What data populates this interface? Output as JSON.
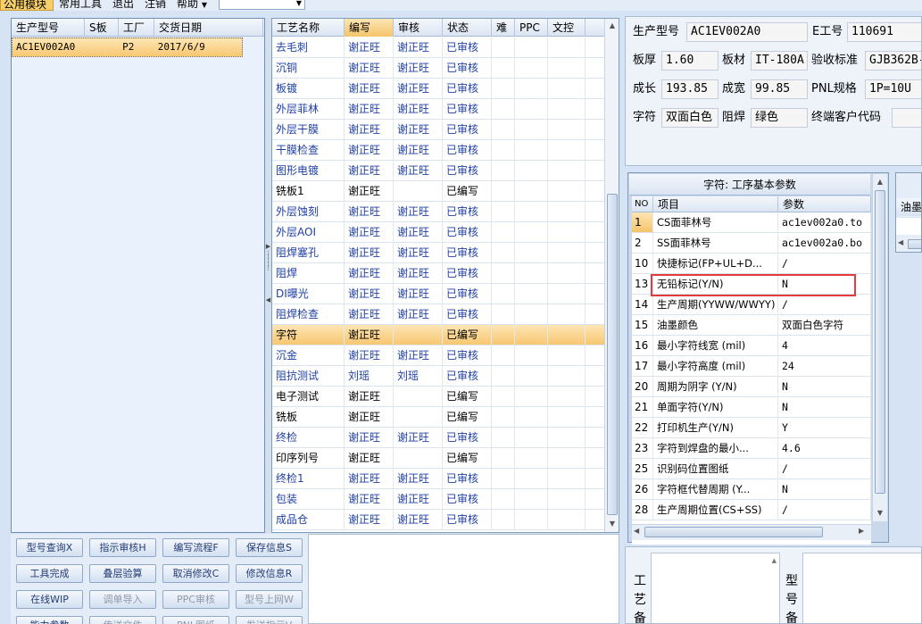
{
  "menubar": {
    "items": [
      "公用模块",
      "常用工具",
      "退出",
      "注销",
      "帮助"
    ],
    "dropdown_value": ""
  },
  "orders": {
    "columns": [
      "生产型号",
      "S板",
      "工厂",
      "交货日期"
    ],
    "rows": [
      [
        "AC1EV002A0",
        "",
        "P2",
        "2017/6/9"
      ]
    ]
  },
  "process": {
    "columns": [
      "工艺名称",
      "编写",
      "审核",
      "状态",
      "难",
      "PPC",
      "文控"
    ],
    "rows": [
      {
        "name": "去毛刺",
        "writer": "谢正旺",
        "reviewer": "谢正旺",
        "status": "已审核"
      },
      {
        "name": "沉铜",
        "writer": "谢正旺",
        "reviewer": "谢正旺",
        "status": "已审核"
      },
      {
        "name": "板镀",
        "writer": "谢正旺",
        "reviewer": "谢正旺",
        "status": "已审核"
      },
      {
        "name": "外层菲林",
        "writer": "谢正旺",
        "reviewer": "谢正旺",
        "status": "已审核"
      },
      {
        "name": "外层干膜",
        "writer": "谢正旺",
        "reviewer": "谢正旺",
        "status": "已审核"
      },
      {
        "name": "干膜检查",
        "writer": "谢正旺",
        "reviewer": "谢正旺",
        "status": "已审核"
      },
      {
        "name": "图形电镀",
        "writer": "谢正旺",
        "reviewer": "谢正旺",
        "status": "已审核"
      },
      {
        "name": "铣板1",
        "writer": "谢正旺",
        "reviewer": "",
        "status": "已编写"
      },
      {
        "name": "外层蚀刻",
        "writer": "谢正旺",
        "reviewer": "谢正旺",
        "status": "已审核"
      },
      {
        "name": "外层AOI",
        "writer": "谢正旺",
        "reviewer": "谢正旺",
        "status": "已审核"
      },
      {
        "name": "阻焊塞孔",
        "writer": "谢正旺",
        "reviewer": "谢正旺",
        "status": "已审核"
      },
      {
        "name": "阻焊",
        "writer": "谢正旺",
        "reviewer": "谢正旺",
        "status": "已审核"
      },
      {
        "name": "DI曝光",
        "writer": "谢正旺",
        "reviewer": "谢正旺",
        "status": "已审核"
      },
      {
        "name": "阻焊检查",
        "writer": "谢正旺",
        "reviewer": "谢正旺",
        "status": "已审核"
      },
      {
        "name": "字符",
        "writer": "谢正旺",
        "reviewer": "",
        "status": "已编写"
      },
      {
        "name": "沉金",
        "writer": "谢正旺",
        "reviewer": "谢正旺",
        "status": "已审核"
      },
      {
        "name": "阻抗测试",
        "writer": "刘瑶",
        "reviewer": "刘瑶",
        "status": "已审核"
      },
      {
        "name": "电子测试",
        "writer": "谢正旺",
        "reviewer": "",
        "status": "已编写"
      },
      {
        "name": "铣板",
        "writer": "谢正旺",
        "reviewer": "",
        "status": "已编写"
      },
      {
        "name": "终检",
        "writer": "谢正旺",
        "reviewer": "谢正旺",
        "status": "已审核"
      },
      {
        "name": "印序列号",
        "writer": "谢正旺",
        "reviewer": "",
        "status": "已编写"
      },
      {
        "name": "终检1",
        "writer": "谢正旺",
        "reviewer": "谢正旺",
        "status": "已审核"
      },
      {
        "name": "包装",
        "writer": "谢正旺",
        "reviewer": "谢正旺",
        "status": "已审核"
      },
      {
        "name": "成品仓",
        "writer": "谢正旺",
        "reviewer": "谢正旺",
        "status": "已审核"
      }
    ]
  },
  "buttons": [
    {
      "label": "型号查询X",
      "enabled": true
    },
    {
      "label": "指示审核H",
      "enabled": true
    },
    {
      "label": "编写流程F",
      "enabled": true
    },
    {
      "label": "保存信息S",
      "enabled": true
    },
    {
      "label": "工具完成",
      "enabled": true
    },
    {
      "label": "叠层验算",
      "enabled": true
    },
    {
      "label": "取消修改C",
      "enabled": true
    },
    {
      "label": "修改信息R",
      "enabled": true
    },
    {
      "label": "在线WIP",
      "enabled": true
    },
    {
      "label": "调单导入",
      "enabled": false
    },
    {
      "label": "PPC审核",
      "enabled": false
    },
    {
      "label": "型号上网W",
      "enabled": false
    },
    {
      "label": "能力参数",
      "enabled": true
    },
    {
      "label": "传送文件",
      "enabled": false
    },
    {
      "label": "PNL图纸",
      "enabled": false
    },
    {
      "label": "发送指示V",
      "enabled": false
    }
  ],
  "info": {
    "model_label": "生产型号",
    "model_value": "AC1EV002A0",
    "eno_label": "E工号",
    "eno_value": "110691",
    "thickness_label": "板厚",
    "thickness_value": "1.60",
    "material_label": "板材",
    "material_value": "IT-180A",
    "standard_label": "验收标准",
    "standard_value": "GJB362B-",
    "length_label": "成长",
    "length_value": "193.85",
    "width_label": "成宽",
    "width_value": "99.85",
    "pnl_label": "PNL规格",
    "pnl_value": "1P=10U",
    "legend_label": "字符",
    "legend_value": "双面白色",
    "mask_label": "阻焊",
    "mask_value": "绿色",
    "customer_label": "终端客户代码",
    "customer_value": ""
  },
  "params": {
    "title": "字符: 工序基本参数",
    "columns": [
      "NO",
      "项目",
      "参数"
    ],
    "rows": [
      [
        "1",
        "CS面菲林号",
        "ac1ev002a0.to"
      ],
      [
        "2",
        "SS面菲林号",
        "ac1ev002a0.bo"
      ],
      [
        "10",
        "快捷标记(FP+UL+D...",
        "/"
      ],
      [
        "13",
        "无铅标记(Y/N)",
        "N"
      ],
      [
        "14",
        "生产周期(YYWW/WWYY)",
        "/"
      ],
      [
        "15",
        "油墨颜色",
        "双面白色字符"
      ],
      [
        "16",
        "最小字符线宽 (mil)",
        "4"
      ],
      [
        "17",
        "最小字符高度 (mil)",
        "24"
      ],
      [
        "20",
        "周期为阴字 (Y/N)",
        "N"
      ],
      [
        "21",
        "单面字符(Y/N)",
        "N"
      ],
      [
        "22",
        "打印机生产(Y/N)",
        "Y"
      ],
      [
        "23",
        "字符到焊盘的最小...",
        "4.6"
      ],
      [
        "25",
        "识别码位置图纸",
        "/"
      ],
      [
        "26",
        "字符框代替周期 (Y...",
        "N"
      ],
      [
        "28",
        "生产周期位置(CS+SS)",
        "/"
      ]
    ]
  },
  "right_partial": {
    "header": "油墨"
  },
  "bottom": {
    "process_note_label": "工艺备",
    "model_note_label": "型号备"
  }
}
